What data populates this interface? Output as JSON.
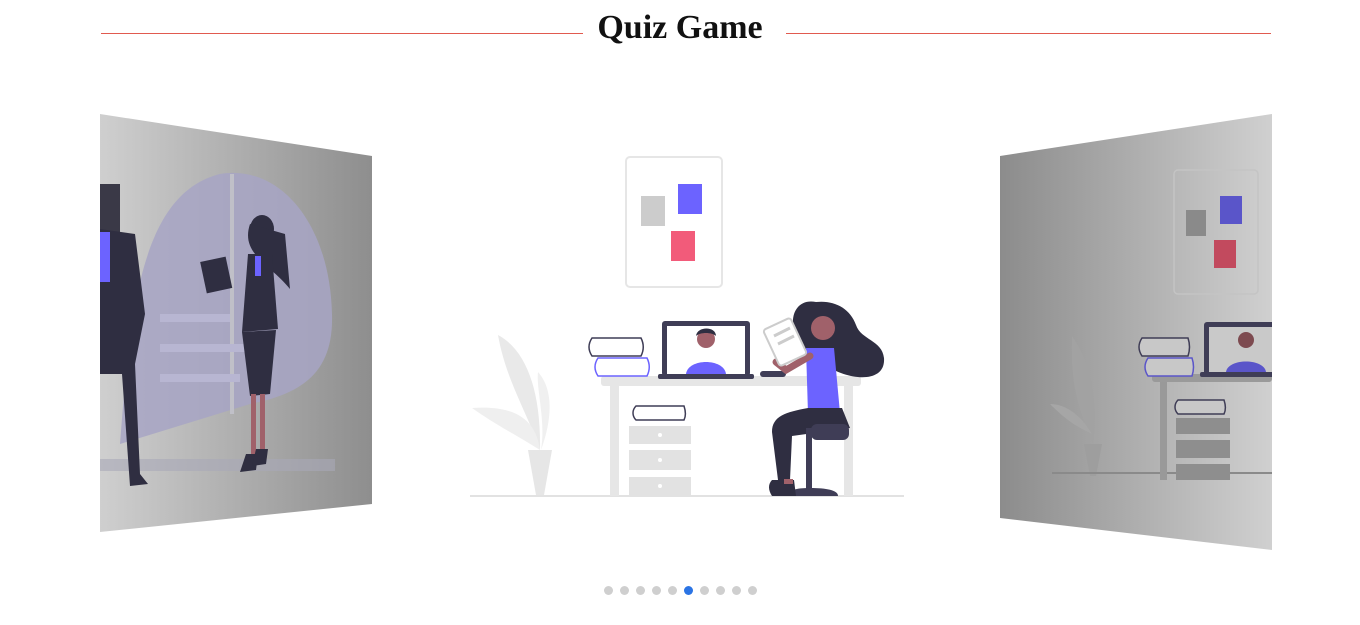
{
  "header": {
    "title": "Quiz Game"
  },
  "carousel": {
    "slide_count": 10,
    "active_index": 5,
    "colors": {
      "accent": "#6c63ff",
      "pink": "#f25b7a",
      "dark": "#2f2e41",
      "rule": "#e15a4f",
      "dot_active": "#2b74e4",
      "dot": "#cfcfcf"
    }
  }
}
